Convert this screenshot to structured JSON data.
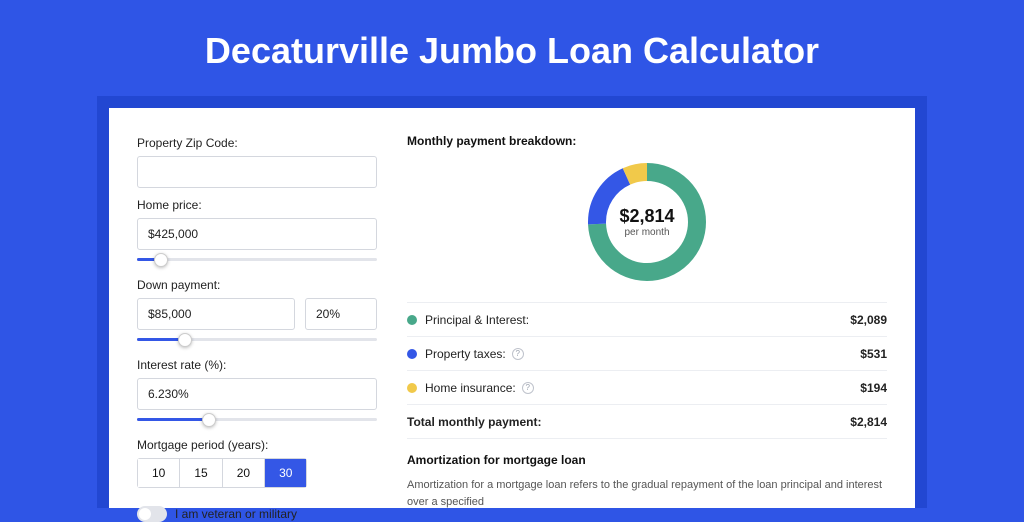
{
  "title": "Decaturville Jumbo Loan Calculator",
  "form": {
    "zip_label": "Property Zip Code:",
    "zip_value": "",
    "home_price_label": "Home price:",
    "home_price_value": "$425,000",
    "home_price_slider_pct": 10,
    "down_label": "Down payment:",
    "down_value": "$85,000",
    "down_pct_value": "20%",
    "down_slider_pct": 20,
    "rate_label": "Interest rate (%):",
    "rate_value": "6.230%",
    "rate_slider_pct": 30,
    "period_label": "Mortgage period (years):",
    "periods": [
      {
        "label": "10",
        "active": false
      },
      {
        "label": "15",
        "active": false
      },
      {
        "label": "20",
        "active": false
      },
      {
        "label": "30",
        "active": true
      }
    ],
    "vet_label": "I am veteran or military"
  },
  "breakdown": {
    "title": "Monthly payment breakdown:",
    "total_amount": "$2,814",
    "total_sub": "per month",
    "rows": [
      {
        "color": "#48a88a",
        "label": "Principal & Interest:",
        "value": "$2,089",
        "info": false
      },
      {
        "color": "#3457e6",
        "label": "Property taxes:",
        "value": "$531",
        "info": true
      },
      {
        "color": "#f1c94a",
        "label": "Home insurance:",
        "value": "$194",
        "info": true
      }
    ],
    "total_row": {
      "label": "Total monthly payment:",
      "value": "$2,814"
    }
  },
  "amort": {
    "title": "Amortization for mortgage loan",
    "body": "Amortization for a mortgage loan refers to the gradual repayment of the loan principal and interest over a specified"
  },
  "chart_data": {
    "type": "pie",
    "title": "Monthly payment breakdown",
    "series": [
      {
        "name": "Principal & Interest",
        "value": 2089,
        "color": "#48a88a"
      },
      {
        "name": "Property taxes",
        "value": 531,
        "color": "#3457e6"
      },
      {
        "name": "Home insurance",
        "value": 194,
        "color": "#f1c94a"
      }
    ],
    "total": 2814,
    "center_label": "$2,814 per month"
  }
}
